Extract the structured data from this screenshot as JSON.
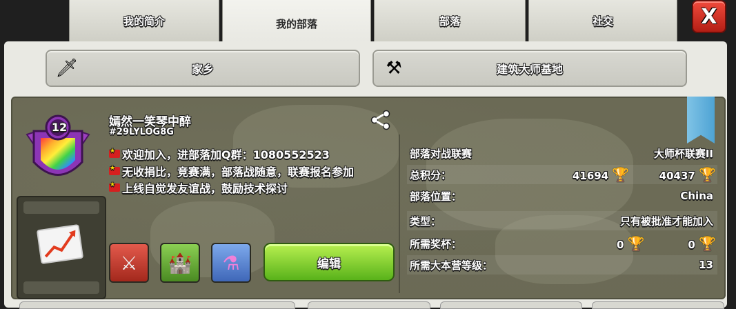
{
  "tabs": [
    "我的简介",
    "我的部落",
    "部落",
    "社交"
  ],
  "close_label": "X",
  "subtabs": {
    "home": "家乡",
    "builder": "建筑大师基地"
  },
  "clan": {
    "level": "12",
    "name": "嫣然一笑琴中醉",
    "tag": "#29LYLOG8G",
    "description": [
      "欢迎加入，进部落加Q群：1080552523",
      "无收捐比，竞赛满，部落战随意，联赛报名参加",
      "上线自觉发友谊战，鼓励技术探讨"
    ],
    "edit_label": "编辑"
  },
  "info": {
    "war_league_label": "部落对战联赛",
    "war_league_value": "大师杯联赛II",
    "points_label": "总积分：",
    "points_home": "41694",
    "points_builder": "40437",
    "location_label": "部落位置：",
    "location_value": "China",
    "type_label": "类型：",
    "type_value": "只有被批准才能加入",
    "req_trophies_label": "所需奖杯：",
    "req_trophies_home": "0",
    "req_trophies_builder": "0",
    "req_th_label": "所需大本营等级：",
    "req_th_value": "13"
  },
  "colors": {
    "accent_green": "#6fc01f",
    "close_red": "#d6332a",
    "map_bg": "#6b6a55"
  }
}
